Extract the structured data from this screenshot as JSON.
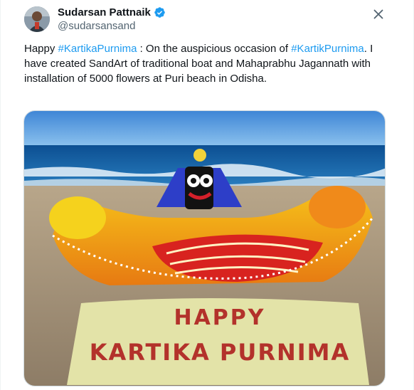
{
  "author": {
    "display_name": "Sudarsan Pattnaik",
    "handle": "@sudarsansand",
    "verified": true,
    "avatar_icon": "user-avatar-photo"
  },
  "close_icon": "close-icon",
  "tweet": {
    "segments": [
      {
        "text": "Happy ",
        "type": "text"
      },
      {
        "text": "#KartikaPurnima",
        "type": "hashtag"
      },
      {
        "text": " : On the auspicious occasion of ",
        "type": "text"
      },
      {
        "text": "#KartikPurnima",
        "type": "hashtag"
      },
      {
        "text": ". I have created SandArt of traditional boat and Mahaprabhu Jagannath with installation of 5000 flowers at Puri beach in Odisha.",
        "type": "text"
      }
    ]
  },
  "media": {
    "banner_line1": "HAPPY",
    "banner_line2": "KARTIKA PURNIMA"
  },
  "colors": {
    "hashtag": "#1d9bf0",
    "verified": "#1d9bf0",
    "text": "#0f1419",
    "secondary": "#536471"
  }
}
